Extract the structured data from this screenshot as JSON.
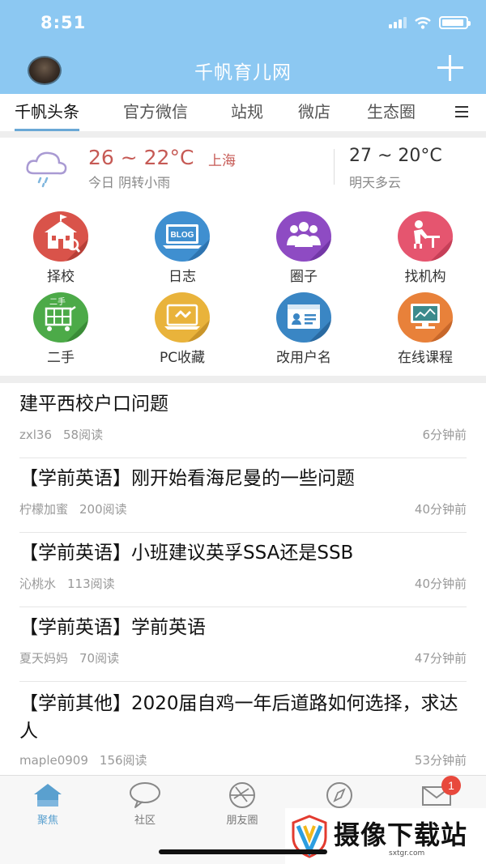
{
  "status_bar": {
    "time": "8:51"
  },
  "header": {
    "title": "千帆育儿网"
  },
  "tabs": [
    {
      "label": "千帆头条",
      "active": true
    },
    {
      "label": "官方微信"
    },
    {
      "label": "站规"
    },
    {
      "label": "微店"
    },
    {
      "label": "生态圈"
    }
  ],
  "weather": {
    "today_temp": "26 ~ 22°C",
    "city": "上海",
    "today_desc": "今日 阴转小雨",
    "tomorrow_temp": "27 ~ 20°C",
    "tomorrow_desc": "明天多云"
  },
  "features": [
    {
      "label": "择校",
      "icon": "school-icon",
      "color": "#d9534a"
    },
    {
      "label": "日志",
      "icon": "blog-icon",
      "color": "#3f8fd0",
      "icon_text": "BLOG"
    },
    {
      "label": "圈子",
      "icon": "group-icon",
      "color": "#8e4bc3"
    },
    {
      "label": "找机构",
      "icon": "reader-icon",
      "color": "#e5556f"
    },
    {
      "label": "二手",
      "icon": "second-hand-icon",
      "color": "#4caa48",
      "icon_text": "二手"
    },
    {
      "label": "PC收藏",
      "icon": "pc-favorite-icon",
      "color": "#e9b33b"
    },
    {
      "label": "改用户名",
      "icon": "id-card-icon",
      "color": "#3a86c4"
    },
    {
      "label": "在线课程",
      "icon": "online-course-icon",
      "color": "#e8813a"
    }
  ],
  "posts": [
    {
      "title": "建平西校户口问题",
      "author": "zxl36",
      "reads": "58阅读",
      "time": "6分钟前"
    },
    {
      "title": "【学前英语】刚开始看海尼曼的一些问题",
      "author": "柠檬加蜜",
      "reads": "200阅读",
      "time": "40分钟前"
    },
    {
      "title": "【学前英语】小班建议英孚SSA还是SSB",
      "author": "沁桃水",
      "reads": "113阅读",
      "time": "40分钟前"
    },
    {
      "title": "【学前英语】学前英语",
      "author": "夏天妈妈",
      "reads": "70阅读",
      "time": "47分钟前"
    },
    {
      "title": "【学前其他】2020届自鸡一年后道路如何选择，求达人",
      "author": "maple0909",
      "reads": "156阅读",
      "time": "53分钟前"
    }
  ],
  "bottom_nav": [
    {
      "label": "聚焦",
      "icon": "home-icon",
      "active": true
    },
    {
      "label": "社区",
      "icon": "chat-bubble-icon"
    },
    {
      "label": "朋友圈",
      "icon": "aperture-icon"
    },
    {
      "label": "",
      "icon": "compass-icon"
    },
    {
      "label": "",
      "icon": "mail-icon",
      "badge": "1"
    }
  ],
  "watermark": {
    "text": "摄像下载站",
    "url": "sxtgr.com"
  },
  "colors": {
    "header_bg": "#8cc8f2",
    "accent": "#5aa0cf",
    "temp_red": "#c65a55"
  }
}
